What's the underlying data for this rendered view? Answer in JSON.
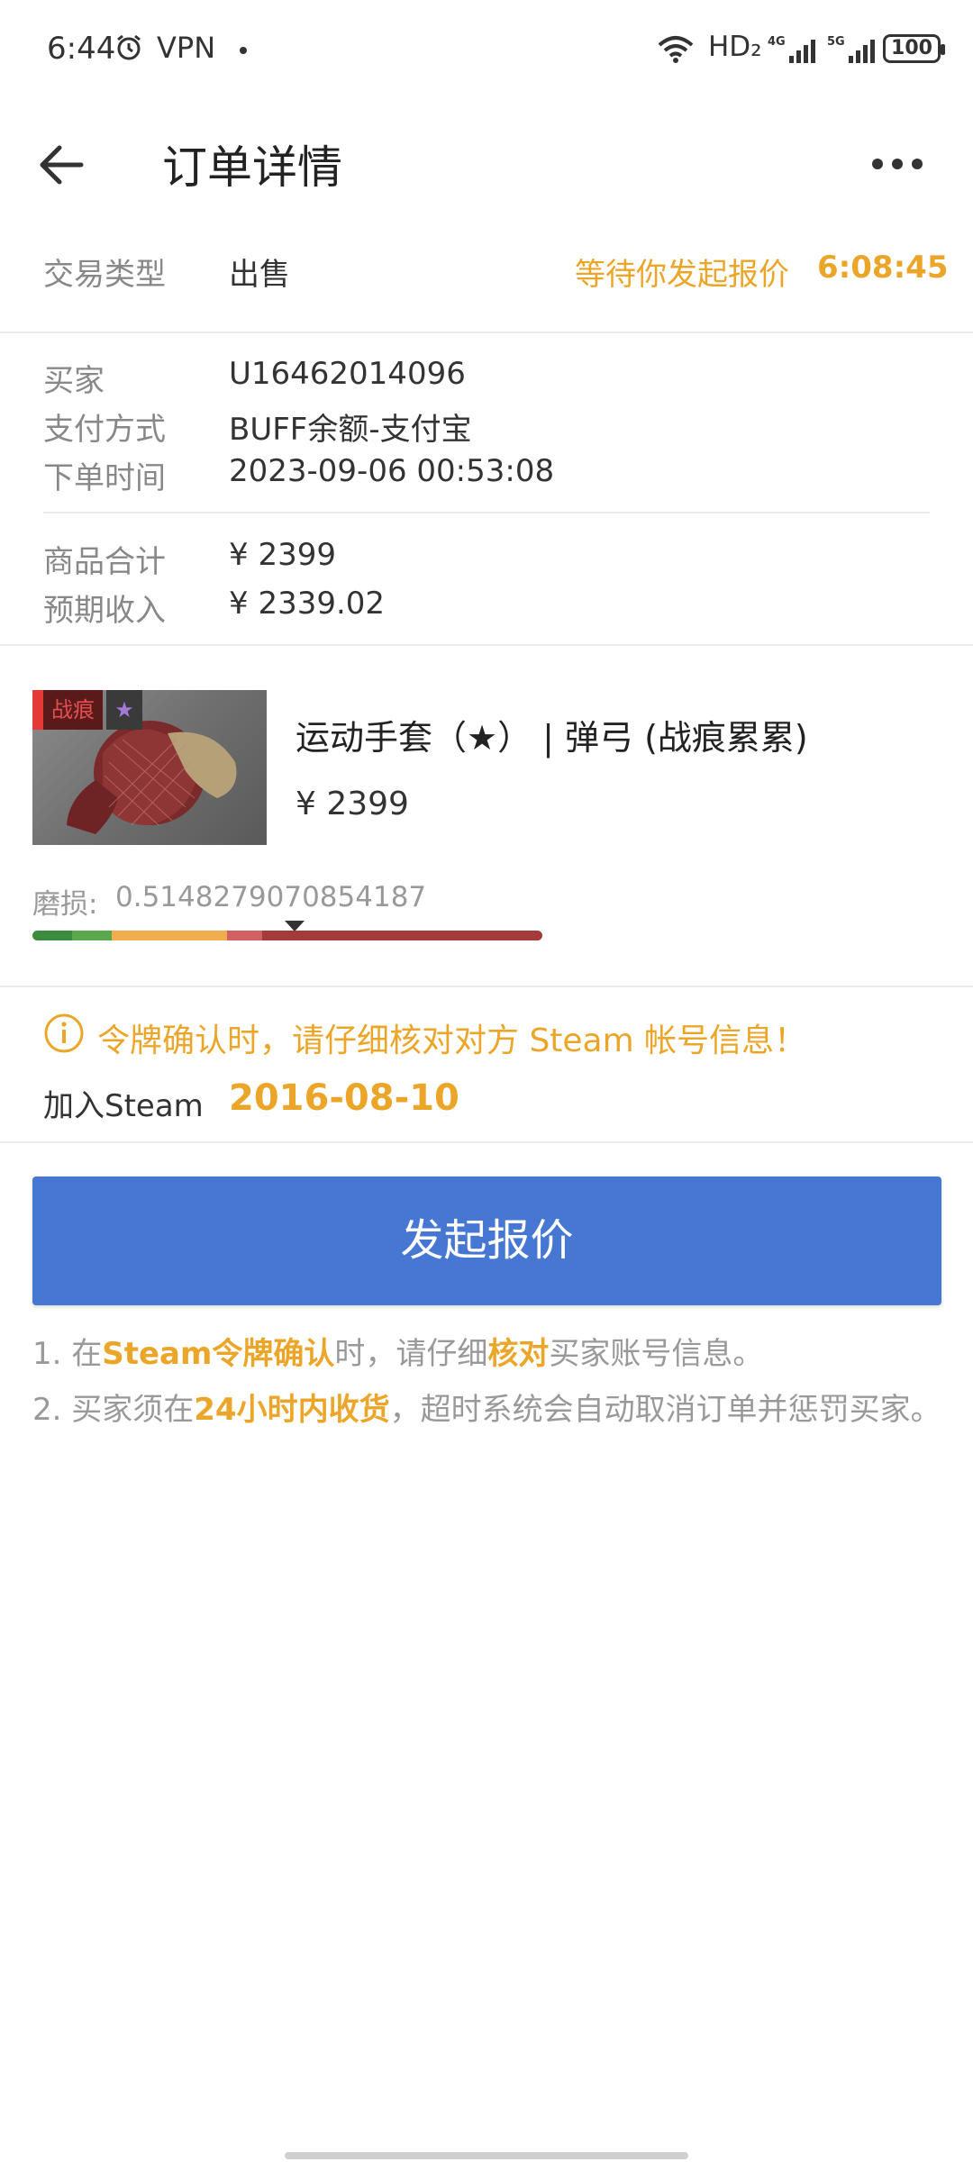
{
  "status_bar": {
    "time": "6:44",
    "vpn": "VPN",
    "network_hd": "HD₂",
    "battery": "100"
  },
  "header": {
    "title": "订单详情"
  },
  "trade": {
    "type_label": "交易类型",
    "type_value": "出售",
    "status_text": "等待你发起报价",
    "countdown": "6:08:45"
  },
  "order": {
    "buyer_label": "买家",
    "buyer_value": "U16462014096",
    "payment_label": "支付方式",
    "payment_value": "BUFF余额-支付宝",
    "time_label": "下单时间",
    "time_value": "2023-09-06 00:53:08"
  },
  "totals": {
    "goods_label": "商品合计",
    "goods_value": "¥ 2399",
    "income_label": "预期收入",
    "income_value": "¥ 2339.02"
  },
  "item": {
    "tag_wear": "战痕",
    "tag_star": "★",
    "name": "运动手套（★） | 弹弓 (战痕累累)",
    "price": "¥ 2399",
    "wear_label": "磨损:",
    "wear_value": "0.5148279070854187",
    "wear_fraction": 0.5148279070854187
  },
  "warning": {
    "text": "令牌确认时，请仔细核对对方 Steam 帐号信息！",
    "steam_join_label": "加入Steam",
    "steam_join_date": "2016-08-10"
  },
  "action": {
    "button_label": "发起报价"
  },
  "notes": {
    "n1_prefix": "1. 在",
    "n1_bold1": "Steam令牌确认",
    "n1_mid": "时，请仔细",
    "n1_bold2": "核对",
    "n1_suffix": "买家账号信息。",
    "n2_prefix": "2. 买家须在",
    "n2_bold": "24小时内收货",
    "n2_suffix": "，超时系统会自动取消订单并惩罚买家。"
  },
  "colors": {
    "accent": "#eba62a",
    "button": "#4577d3"
  }
}
